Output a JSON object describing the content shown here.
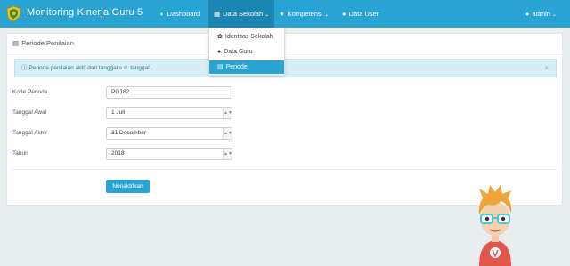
{
  "app": {
    "title": "Monitoring Kinerja Guru 5",
    "logo_icon": "emblem-icon"
  },
  "nav": {
    "dashboard": "Dashboard",
    "data_sekolah": "Data Sekolah",
    "kompetensi": "Kompetensi",
    "data_user": "Data User",
    "user_menu": "admin"
  },
  "dropdown": {
    "items": [
      {
        "label": "Identitas Sekolah",
        "icon": "leaf-icon"
      },
      {
        "label": "Data Guru",
        "icon": "user-icon"
      },
      {
        "label": "Periode",
        "icon": "calendar-icon"
      }
    ]
  },
  "panel": {
    "title": "Periode Penilaian",
    "alert": "Periode penilaian aktif dari tanggal s.d. tanggal .",
    "alert_close": "×"
  },
  "form": {
    "kode_label": "Kode Periode",
    "kode_value": "PG182",
    "tanggal_awal_label": "Tanggal Awal",
    "tanggal_awal_value": "1 Juli",
    "tanggal_akhir_label": "Tanggal Akhir",
    "tanggal_akhir_value": "31 Desember",
    "tahun_label": "Tahun",
    "tahun_value": "2018",
    "button": "Nonaktifkan"
  },
  "colors": {
    "navbar": "#29a3d1",
    "nav_active": "#1c86b3",
    "alert_bg": "#d7eef5",
    "button": "#29a3d1"
  }
}
